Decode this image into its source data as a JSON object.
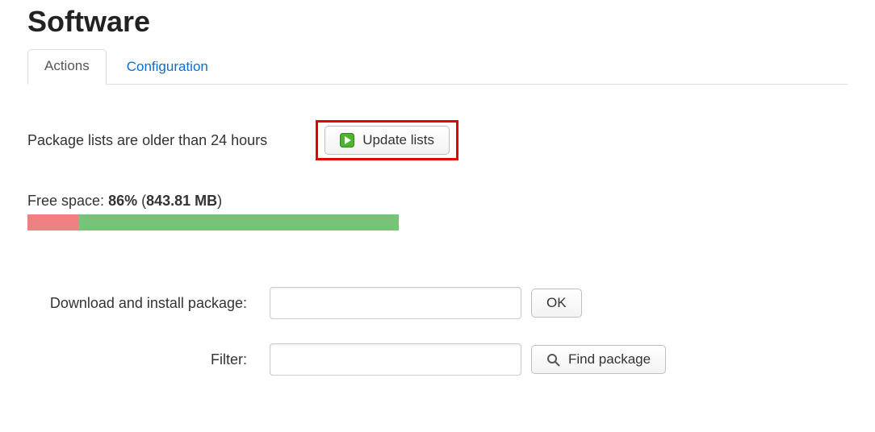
{
  "page_title": "Software",
  "tabs": [
    {
      "label": "Actions",
      "active": true
    },
    {
      "label": "Configuration",
      "active": false
    }
  ],
  "status_message": "Package lists are older than 24 hours",
  "update_button_label": "Update lists",
  "update_button_highlighted": true,
  "free_space": {
    "label": "Free space:",
    "percent_text": "86%",
    "size_text": "843.81 MB",
    "used_pct": 14,
    "free_pct": 86
  },
  "form": {
    "download_label": "Download and install package:",
    "download_value": "",
    "ok_label": "OK",
    "filter_label": "Filter:",
    "filter_value": "",
    "find_label": "Find package"
  },
  "colors": {
    "highlight": "#e60000",
    "link": "#0f6ecd",
    "bar_used": "#ee8282",
    "bar_free": "#77c479"
  }
}
